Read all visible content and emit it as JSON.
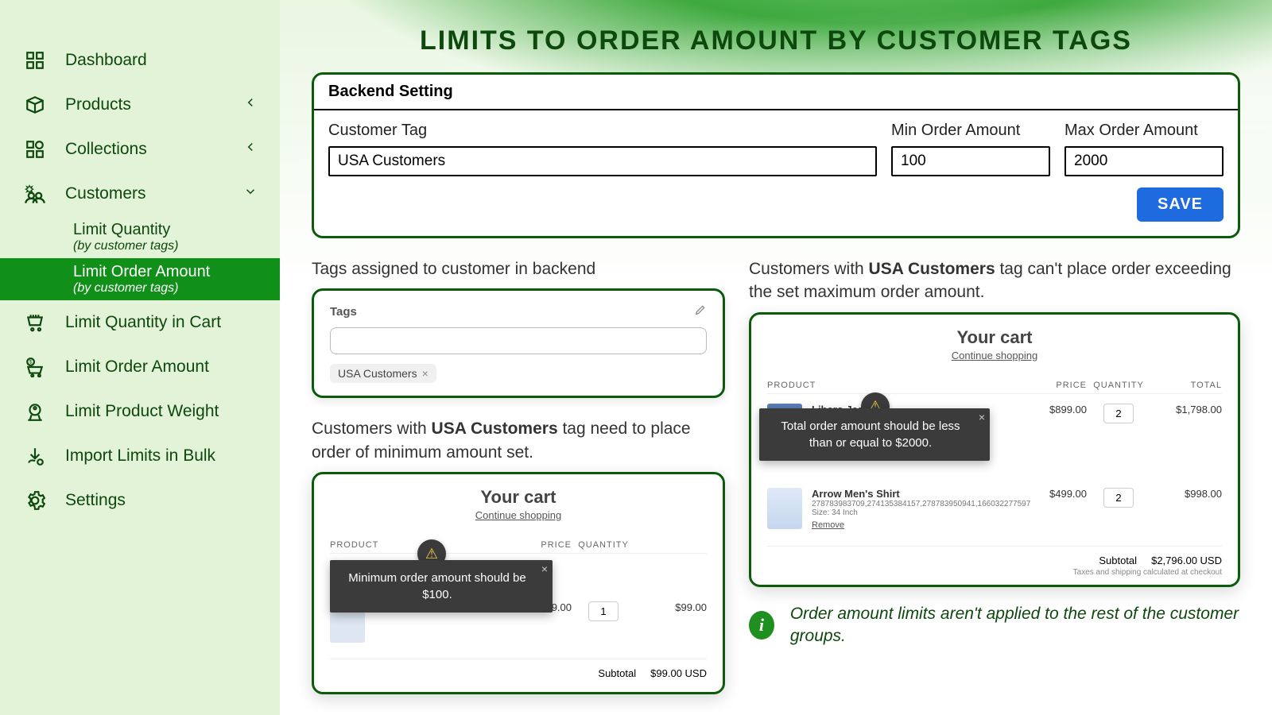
{
  "sidebar": {
    "items": [
      {
        "label": "Dashboard"
      },
      {
        "label": "Products"
      },
      {
        "label": "Collections"
      },
      {
        "label": "Customers"
      }
    ],
    "sub": [
      {
        "label": "Limit Quantity",
        "subtitle": "(by customer tags)"
      },
      {
        "label": "Limit Order Amount",
        "subtitle": "(by customer tags)"
      }
    ],
    "after": [
      {
        "label": "Limit Quantity in Cart"
      },
      {
        "label": "Limit Order Amount"
      },
      {
        "label": "Limit Product Weight"
      },
      {
        "label": "Import Limits in Bulk"
      },
      {
        "label": "Settings"
      }
    ]
  },
  "title": "LIMITS TO ORDER AMOUNT BY CUSTOMER TAGS",
  "backend": {
    "header": "Backend Setting",
    "tag_label": "Customer Tag",
    "tag_value": "USA Customers",
    "min_label": "Min Order Amount",
    "min_value": "100",
    "max_label": "Max Order Amount",
    "max_value": "2000",
    "save": "SAVE"
  },
  "tags_caption": "Tags assigned to customer in backend",
  "tagbox": {
    "header": "Tags",
    "chip": "USA Customers"
  },
  "min_caption_pre": "Customers with ",
  "min_caption_bold": "USA Customers",
  "min_caption_post": " tag need to place order of minimum amount set.",
  "max_caption_pre": "Customers with ",
  "max_caption_bold": "USA Customers",
  "max_caption_post": " tag can't place order exceeding the set maximum order amount.",
  "cartL": {
    "title": "Your cart",
    "continue": "Continue shopping",
    "heads": {
      "product": "PRODUCT",
      "price": "PRICE",
      "qty": "QUANTITY"
    },
    "toast": "Minimum order amount should be $100.",
    "row1": {
      "price": "$99.00",
      "qty": "1",
      "tot": "$99.00"
    },
    "subtotal_label": "Subtotal",
    "subtotal_value": "$99.00 USD"
  },
  "cartR": {
    "title": "Your cart",
    "continue": "Continue shopping",
    "heads": {
      "product": "PRODUCT",
      "price": "PRICE",
      "qty": "QUANTITY",
      "total": "TOTAL"
    },
    "toast": "Total order amount should be less than or equal to $2000.",
    "row1": {
      "name": "Libero Jeans",
      "price": "$899.00",
      "qty": "2",
      "tot": "$1,798.00"
    },
    "row2": {
      "name": "Arrow Men's Shirt",
      "meta": "278783983709,274135384157,278783950941,166032277597",
      "size": "Size: 34 Inch",
      "remove": "Remove",
      "price": "$499.00",
      "qty": "2",
      "tot": "$998.00"
    },
    "subtotal_label": "Subtotal",
    "subtotal_value": "$2,796.00 USD",
    "note": "Taxes and shipping calculated at checkout"
  },
  "info": "Order amount limits aren't applied to the rest of the customer groups."
}
